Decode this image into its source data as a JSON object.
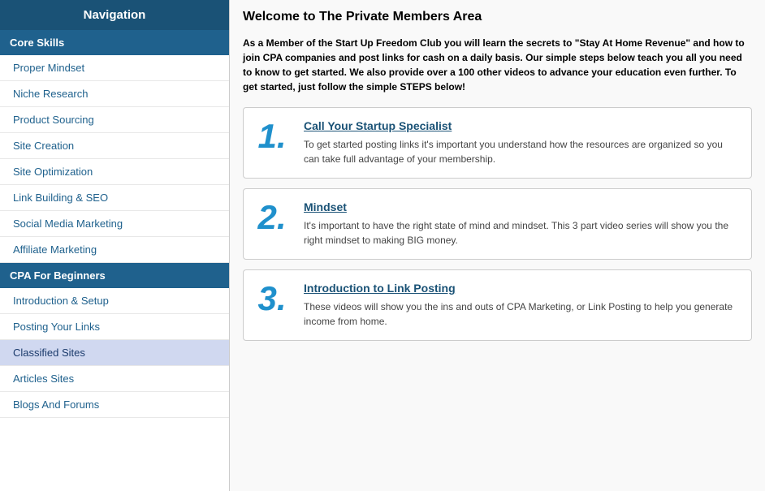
{
  "sidebar": {
    "header": "Navigation",
    "sections": [
      {
        "label": "Core Skills",
        "items": [
          {
            "id": "proper-mindset",
            "label": "Proper Mindset",
            "active": false
          },
          {
            "id": "niche-research",
            "label": "Niche Research",
            "active": false
          },
          {
            "id": "product-sourcing",
            "label": "Product Sourcing",
            "active": false
          },
          {
            "id": "site-creation",
            "label": "Site Creation",
            "active": false
          },
          {
            "id": "site-optimization",
            "label": "Site Optimization",
            "active": false
          },
          {
            "id": "link-building-seo",
            "label": "Link Building & SEO",
            "active": false
          },
          {
            "id": "social-media-marketing",
            "label": "Social Media Marketing",
            "active": false
          },
          {
            "id": "affiliate-marketing",
            "label": "Affiliate Marketing",
            "active": false
          }
        ]
      },
      {
        "label": "CPA For Beginners",
        "items": [
          {
            "id": "introduction-setup",
            "label": "Introduction & Setup",
            "active": false
          },
          {
            "id": "posting-your-links",
            "label": "Posting Your Links",
            "active": false
          },
          {
            "id": "classified-sites",
            "label": "Classified Sites",
            "active": true
          },
          {
            "id": "articles-sites",
            "label": "Articles Sites",
            "active": false
          },
          {
            "id": "blogs-and-forums",
            "label": "Blogs And Forums",
            "active": false
          }
        ]
      }
    ]
  },
  "main": {
    "title": "Welcome to The Private Members Area",
    "intro": "As a Member of the Start Up Freedom Club you will learn the secrets to \"Stay At Home Revenue\" and how to join CPA companies and post links for cash on a daily basis. Our simple steps below teach you all you need to know to get started. We also provide over a 100 other videos to advance your education even further. To get started, just follow the simple STEPS below!",
    "steps": [
      {
        "number": "1.",
        "title": "Call Your Startup Specialist",
        "description": "To get started posting links it's important you understand how the resources are organized so you can take full advantage of your membership."
      },
      {
        "number": "2.",
        "title": "Mindset",
        "description": "It's important to have the right state of mind and mindset. This 3 part video series will show you the right mindset to making BIG money."
      },
      {
        "number": "3.",
        "title": "Introduction to Link Posting",
        "description": "These videos will show you the ins and outs of CPA Marketing, or Link Posting to help you generate income from home."
      }
    ]
  }
}
